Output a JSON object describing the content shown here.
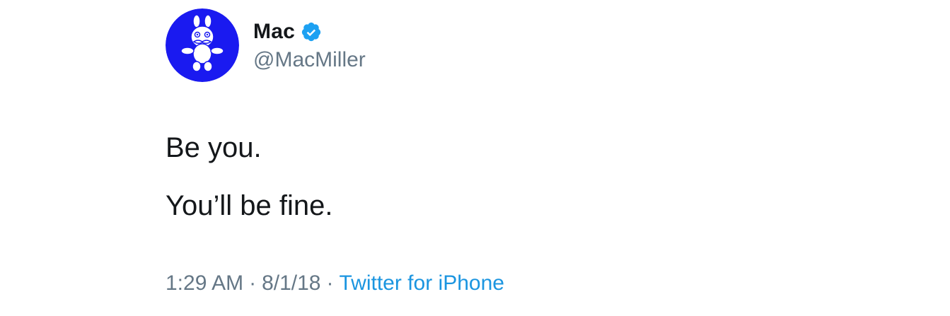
{
  "tweet": {
    "author": {
      "display_name": "Mac",
      "handle": "@MacMiller",
      "verified": true,
      "avatar_icon": "avatar-blue-character-icon",
      "verified_icon": "verified-badge-icon",
      "avatar_bg_color": "#1a1af0",
      "verified_color": "#1da1f2"
    },
    "lines": [
      "Be you.",
      "You’ll be fine."
    ],
    "time": "1:29 AM",
    "separator": "·",
    "date": "8/1/18",
    "source": "Twitter for iPhone",
    "source_color": "#1b95e0",
    "meta_color": "#657786"
  }
}
